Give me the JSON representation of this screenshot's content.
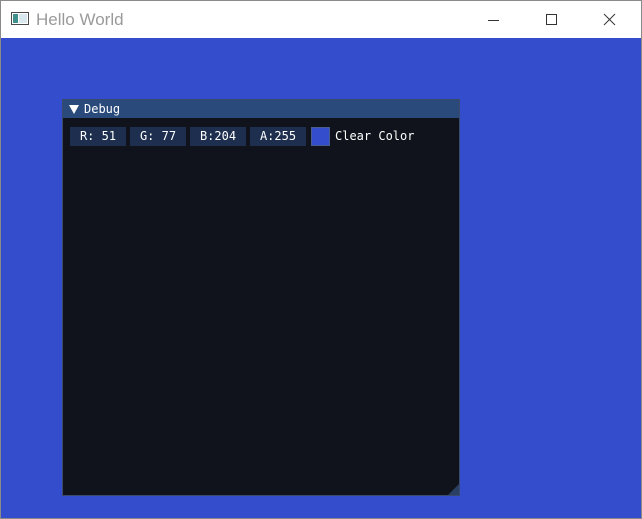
{
  "window": {
    "title": "Hello World",
    "app_icon": "window-app-icon",
    "controls": {
      "minimize_icon": "minimize-icon",
      "maximize_icon": "maximize-icon",
      "close_icon": "close-icon"
    }
  },
  "debug_window": {
    "title": "Debug",
    "collapse_icon": "triangle-down-icon",
    "color_edit": {
      "r_text": "R: 51",
      "g_text": "G: 77",
      "b_text": "B:204",
      "a_text": "A:255",
      "label": "Clear Color",
      "r": 51,
      "g": 77,
      "b": 204,
      "a": 255
    }
  },
  "colors": {
    "clear_color": "#334dcc",
    "imgui_window_bg": "#10131b",
    "imgui_title_bg": "#294a7a",
    "imgui_frame_bg": "#1d2e4e"
  }
}
